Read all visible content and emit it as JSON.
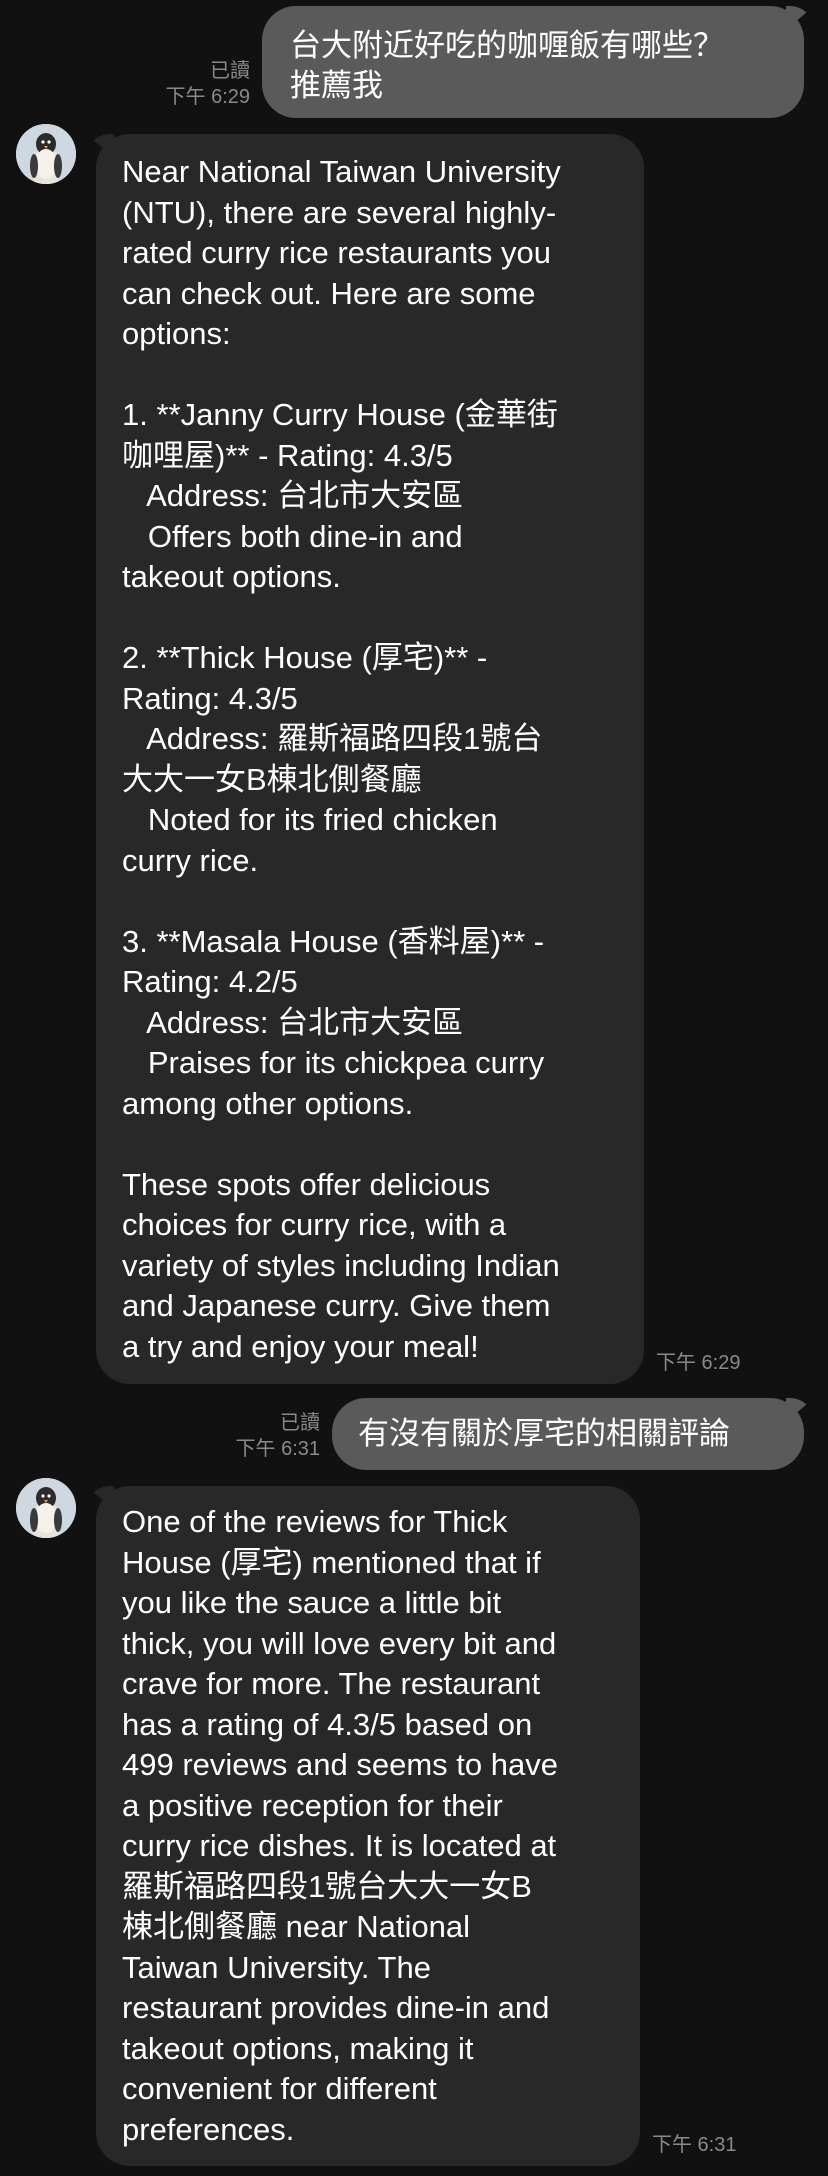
{
  "messages": [
    {
      "sender": "user",
      "read_label": "已讀",
      "time": "下午 6:29",
      "lines": [
        "台大附近好吃的咖喱飯有哪些？",
        "推薦我"
      ]
    },
    {
      "sender": "bot",
      "time": "下午 6:29",
      "lines": [
        "Near National Taiwan University",
        "(NTU), there are several highly-",
        "rated curry rice restaurants you",
        "can check out. Here are some",
        "options:",
        "",
        "1. **Janny Curry House (金華街",
        "咖哩屋)** - Rating: 4.3/5",
        "   Address: 台北市大安區",
        "   Offers both dine-in and",
        "takeout options.",
        "",
        "2. **Thick House (厚宅)** -",
        "Rating: 4.3/5",
        "   Address: 羅斯福路四段1號台",
        "大大一女B棟北側餐廳",
        "   Noted for its fried chicken",
        "curry rice.",
        "",
        "3. **Masala House (香料屋)** -",
        "Rating: 4.2/5",
        "   Address: 台北市大安區",
        "   Praises for its chickpea curry",
        "among other options.",
        "",
        "These spots offer delicious",
        "choices for curry rice, with a",
        "variety of styles including Indian",
        "and Japanese curry. Give them",
        "a try and enjoy your meal!"
      ]
    },
    {
      "sender": "user",
      "read_label": "已讀",
      "time": "下午 6:31",
      "lines": [
        "有沒有關於厚宅的相關評論"
      ]
    },
    {
      "sender": "bot",
      "time": "下午 6:31",
      "lines": [
        "One of the reviews for Thick",
        "House (厚宅) mentioned that if",
        "you like the sauce a little bit",
        "thick, you will love every bit and",
        "crave for more. The restaurant",
        "has a rating of 4.3/5 based on",
        "499 reviews and seems to have",
        "a positive reception for their",
        "curry rice dishes. It is located at",
        "羅斯福路四段1號台大大一女B",
        "棟北側餐廳 near National",
        "Taiwan University. The",
        "restaurant provides dine-in and",
        "takeout options, making it",
        "convenient for different",
        "preferences."
      ]
    }
  ],
  "colors": {
    "background": "#111111",
    "outgoing_bubble": "#5a5a5a",
    "incoming_bubble": "#282828",
    "meta_text": "#8a8a8a"
  },
  "icons": {
    "avatar": "penguin-avatar-icon"
  }
}
